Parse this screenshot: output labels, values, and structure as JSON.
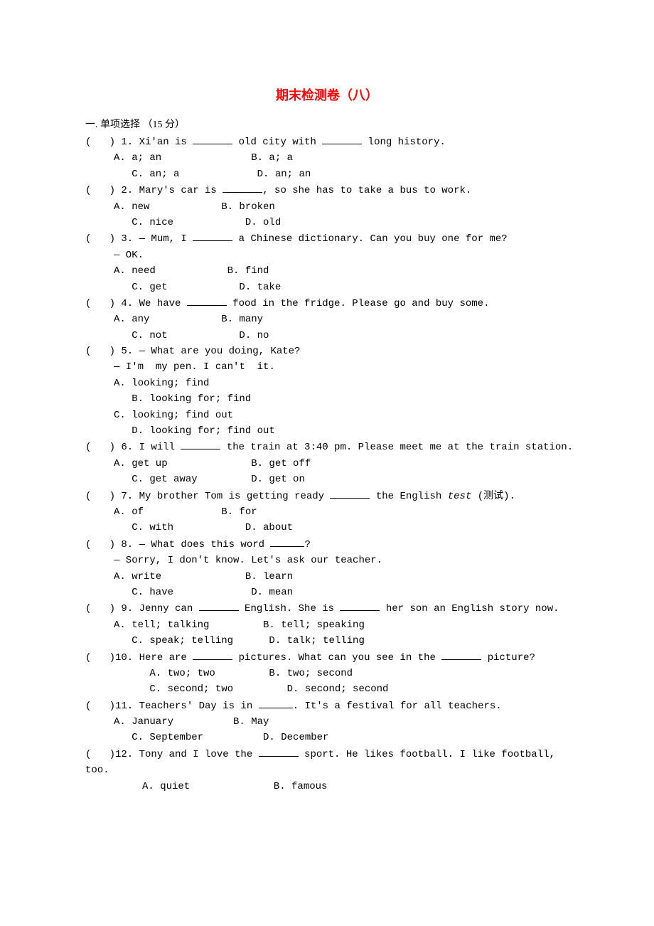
{
  "title": "期末检测卷（八）",
  "section": "一. 单项选择 （15 分）",
  "questions": [
    {
      "n": "1",
      "stem_pre": "(   ) 1. Xi'an is ",
      "stem_mid": " old city with ",
      "stem_post": " long history.",
      "opts_row1": "A. a; an               B. a; a",
      "opts_row2": "   C. an; a             D. an; an"
    },
    {
      "n": "2",
      "stem_pre": "(   ) 2. Mary's car is ",
      "stem_post": ", so she has to take a bus to work.",
      "opts_row1": "A. new            B. broken",
      "opts_row2": "   C. nice            D. old"
    },
    {
      "n": "3",
      "stem_pre": "(   ) 3. — Mum, I ",
      "stem_post": " a Chinese dictionary. Can you buy one for me?",
      "sub": "— OK.",
      "opts_row1": "A. need            B. find",
      "opts_row2": "   C. get            D. take"
    },
    {
      "n": "4",
      "stem_pre": "(   ) 4. We have ",
      "stem_post": " food in the fridge. Please go and buy some.",
      "opts_row1": "A. any            B. many",
      "opts_row2": "   C. not            D. no"
    },
    {
      "n": "5",
      "stem_plain": "(   ) 5. — What are you doing, Kate?",
      "sub_pre": "— I'm ",
      "sub_mid": " my pen. I can't ",
      "sub_post": " it.",
      "opts_rows": [
        "A. looking; find",
        "   B. looking for; find",
        "C. looking; find out",
        "   D. looking for; find out"
      ]
    },
    {
      "n": "6",
      "stem_pre": "(   ) 6. I will ",
      "stem_post": " the train at 3:40 pm. Please meet me at the train station.",
      "opts_row1": "A. get up              B. get off",
      "opts_row2": "   C. get away         D. get on"
    },
    {
      "n": "7",
      "stem_pre": "(   ) 7. My brother Tom is getting ready ",
      "stem_post_italic_word": "test",
      "stem_post_before": " the English ",
      "stem_post_after": " (测试).",
      "opts_row1": "A. of             B. for",
      "opts_row2": "   C. with            D. about"
    },
    {
      "n": "8",
      "stem_pre": "(   ) 8. — What does this word ",
      "stem_post": "?",
      "sub": "— Sorry, I don't know. Let's ask our teacher.",
      "opts_row1": "A. write              B. learn",
      "opts_row2": "   C. have             D. mean"
    },
    {
      "n": "9",
      "stem_pre": "(   ) 9. Jenny can ",
      "stem_mid": " English. She is ",
      "stem_post": " her son an English story now.",
      "opts_row1": "A. tell; talking         B. tell; speaking",
      "opts_row2": "   C. speak; telling      D. talk; telling"
    },
    {
      "n": "10",
      "stem_pre": "(   )10. Here are ",
      "stem_mid": " pictures. What can you see in the ",
      "stem_post": " picture?",
      "opts_row1": "      A. two; two         B. two; second",
      "opts_row2": "      C. second; two         D. second; second"
    },
    {
      "n": "11",
      "stem_pre": "(   )11. Teachers' Day is in ",
      "stem_post": ". It's a festival for all teachers.",
      "opts_row1": "A. January          B. May",
      "opts_row2": "   C. September          D. December"
    },
    {
      "n": "12",
      "stem_pre": "(   )12. Tony and I love the ",
      "stem_post": " sport. He likes football. I like football,",
      "sub": "too.",
      "opts_row1": "A. quiet              B. famous"
    }
  ]
}
